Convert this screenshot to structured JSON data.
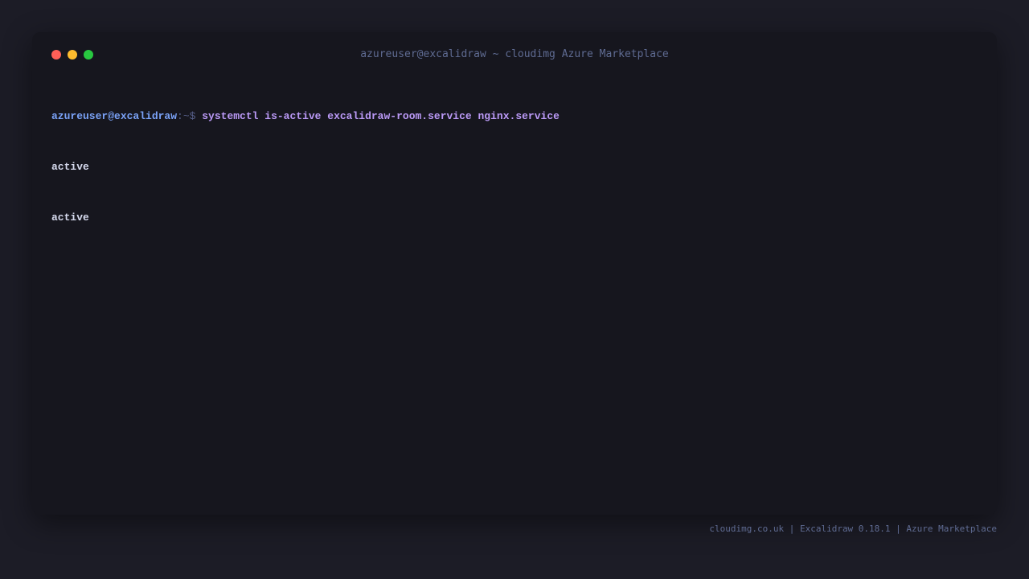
{
  "window": {
    "title": "azureuser@excalidraw ~ cloudimg Azure Marketplace",
    "controls": {
      "close_color": "#ff5f57",
      "minimize_color": "#febc2e",
      "maximize_color": "#28c840"
    }
  },
  "terminal": {
    "prompt": {
      "user_host": "azureuser@excalidraw",
      "path_symbol": ":~$ "
    },
    "command": "systemctl is-active excalidraw-room.service nginx.service",
    "output": [
      "active",
      "active"
    ]
  },
  "footer": {
    "text": "cloudimg.co.uk | Excalidraw 0.18.1 | Azure Marketplace"
  },
  "colors": {
    "background": "#1c1c26",
    "window_bg": "#16161e",
    "prompt_user": "#7aa2f7",
    "command": "#bb9af7",
    "output": "#d7dbef",
    "muted": "#5f6b92"
  }
}
